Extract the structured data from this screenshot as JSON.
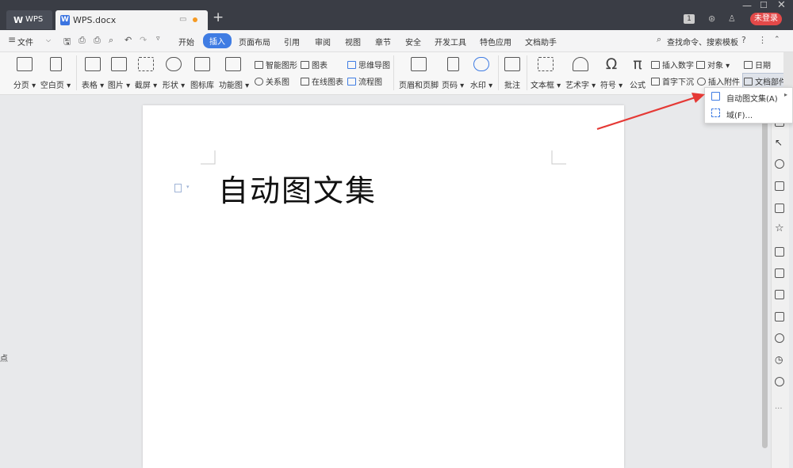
{
  "window": {
    "wps_tab_label": "WPS",
    "doc_tab_label": "WPS.docx",
    "new_tab_symbol": "+",
    "badge_number": "1",
    "login_button": "未登录"
  },
  "menubar": {
    "file_menu": "文件",
    "items": [
      "开始",
      "插入",
      "页面布局",
      "引用",
      "审阅",
      "视图",
      "章节",
      "安全",
      "开发工具",
      "特色应用",
      "文档助手"
    ],
    "active_item": "插入",
    "search_label": "查找命令、搜索模板",
    "help_symbol": "?"
  },
  "ribbon": {
    "page_break": "分页",
    "blank_page": "空白页",
    "table": "表格",
    "picture": "图片",
    "screenshot": "截屏",
    "shape": "形状",
    "icon_library": "图标库",
    "function_chart": "功能图",
    "smart_shape": "智能图形",
    "chart": "图表",
    "mind_map": "思维导图",
    "relation_diagram": "关系图",
    "online_chart": "在线图表",
    "flowchart": "流程图",
    "header_footer": "页眉和页脚",
    "page_number": "页码",
    "watermark": "水印",
    "comment": "批注",
    "text_box": "文本框",
    "word_art": "艺术字",
    "symbol": "符号",
    "formula": "公式",
    "insert_number": "插入数字",
    "object": "对象",
    "date": "日期",
    "drop_cap": "首字下沉",
    "insert_attachment": "插入附件",
    "doc_parts": "文档部件"
  },
  "dropdown": {
    "items": [
      {
        "label": "自动图文集(A)",
        "has_submenu": true
      },
      {
        "label": "域(F)..."
      }
    ]
  },
  "document": {
    "body_text": "自动图文集"
  },
  "left_edge_text": "点",
  "colors": {
    "titlebar": "#3a3d45",
    "accent": "#3f7ce3",
    "login": "#e34949",
    "annotation_arrow": "#e53935"
  }
}
